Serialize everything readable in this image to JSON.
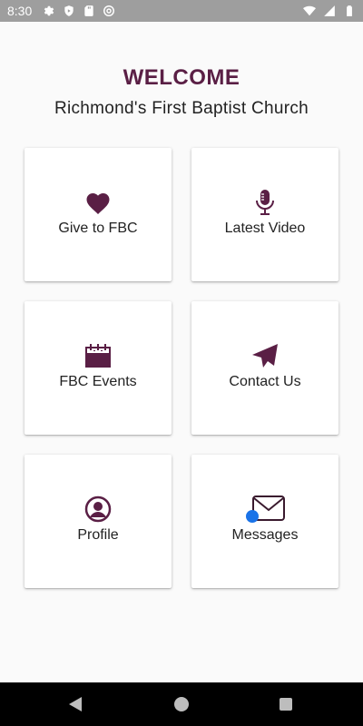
{
  "status_bar": {
    "time": "8:30",
    "left_icons": [
      "gear-icon",
      "shield-icon",
      "sd-card-icon",
      "at-sign-icon"
    ],
    "right_icons": [
      "wifi-icon",
      "cellular-icon",
      "battery-icon"
    ]
  },
  "header": {
    "title": "WELCOME",
    "subtitle": "Richmond's First Baptist Church"
  },
  "tiles": [
    {
      "label": "Give to FBC",
      "icon": "heart-icon"
    },
    {
      "label": "Latest Video",
      "icon": "microphone-icon"
    },
    {
      "label": "FBC Events",
      "icon": "calendar-icon"
    },
    {
      "label": "Contact Us",
      "icon": "paper-plane-icon"
    },
    {
      "label": "Profile",
      "icon": "profile-icon"
    },
    {
      "label": "Messages",
      "icon": "envelope-icon"
    }
  ],
  "nav_bar": {
    "buttons": [
      "back-icon",
      "home-icon",
      "recents-icon"
    ]
  },
  "colors": {
    "accent": "#5a1f45",
    "notification_dot": "#1a73e8",
    "status_bar": "#9e9e9e",
    "background": "#fafafa"
  }
}
